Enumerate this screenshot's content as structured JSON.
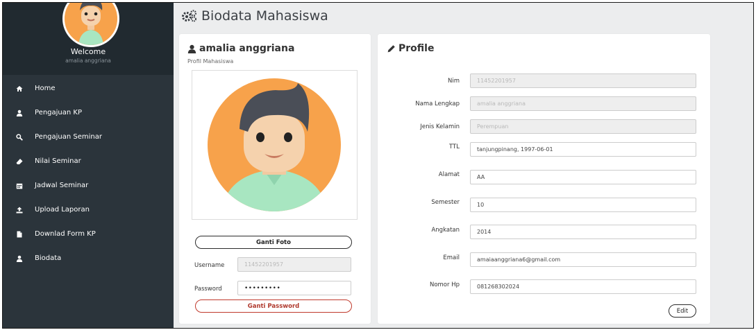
{
  "page": {
    "title": "Biodata Mahasiswa"
  },
  "sidebar": {
    "welcome": "Welcome",
    "username": "amalia anggriana",
    "items": [
      {
        "label": "Home",
        "icon": "home-icon"
      },
      {
        "label": "Pengajuan KP",
        "icon": "user-icon"
      },
      {
        "label": "Pengajuan Seminar",
        "icon": "search-icon"
      },
      {
        "label": "Nilai Seminar",
        "icon": "eraser-icon"
      },
      {
        "label": "Jadwal Seminar",
        "icon": "calendar-icon"
      },
      {
        "label": "Upload Laporan",
        "icon": "upload-icon"
      },
      {
        "label": "Downlad Form KP",
        "icon": "file-icon"
      },
      {
        "label": "Biodata",
        "icon": "user-icon"
      }
    ]
  },
  "profile_card": {
    "name": "amalia anggriana",
    "subtitle": "Profil Mahasiswa",
    "ganti_foto": "Ganti Foto",
    "username_label": "Username",
    "username_value": "11452201957",
    "password_label": "Password",
    "password_value": "•••••••••",
    "ganti_password": "Ganti Password"
  },
  "profile_form": {
    "title": "Profile",
    "fields": [
      {
        "label": "Nim",
        "value": "11452201957",
        "readonly": true
      },
      {
        "label": "Nama Lengkap",
        "value": "amalia anggriana",
        "readonly": true
      },
      {
        "label": "Jenis Kelamin",
        "value": "Perempuan",
        "readonly": true
      },
      {
        "label": "TTL",
        "value": "tanjungpinang, 1997-06-01",
        "readonly": false
      },
      {
        "label": "Alamat",
        "value": "AA",
        "readonly": false
      },
      {
        "label": "Semester",
        "value": "10",
        "readonly": false
      },
      {
        "label": "Angkatan",
        "value": "2014",
        "readonly": false
      },
      {
        "label": "Email",
        "value": "amaiaanggriana6@gmail.com",
        "readonly": false
      },
      {
        "label": "Nomor Hp",
        "value": "081268302024",
        "readonly": false
      }
    ],
    "edit_label": "Edit"
  },
  "colors": {
    "sidebar_bg": "#2b343b",
    "avatar_bg": "#f7a24b",
    "danger": "#c0392b"
  }
}
